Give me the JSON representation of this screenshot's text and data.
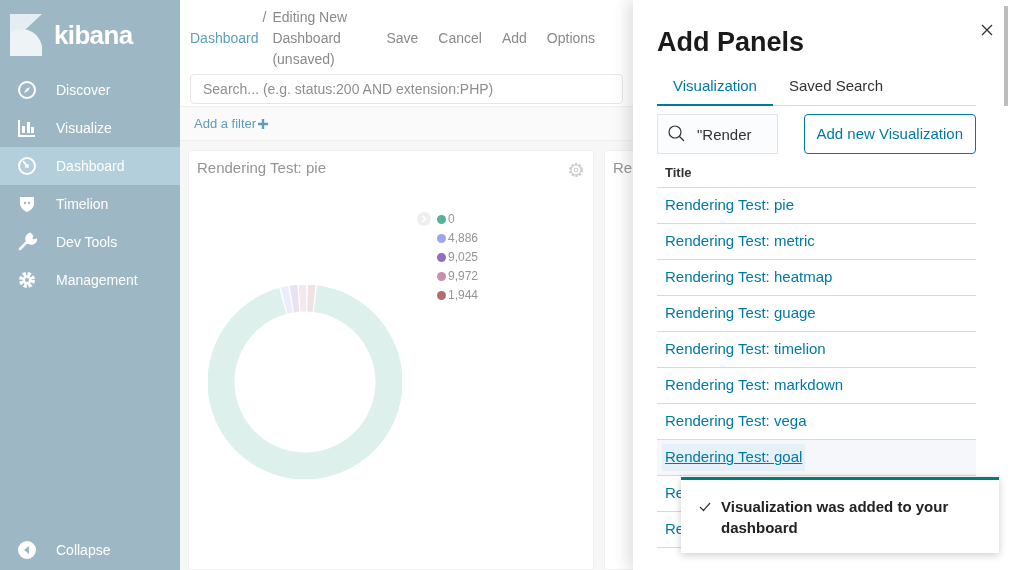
{
  "sidebar": {
    "brand": "kibana",
    "items": [
      {
        "label": "Discover",
        "selected": false
      },
      {
        "label": "Visualize",
        "selected": false
      },
      {
        "label": "Dashboard",
        "selected": true
      },
      {
        "label": "Timelion",
        "selected": false
      },
      {
        "label": "Dev Tools",
        "selected": false
      },
      {
        "label": "Management",
        "selected": false
      }
    ],
    "collapse": "Collapse"
  },
  "top_nav": {
    "breadcrumb": "Dashboard",
    "separator": "/",
    "page_title": "Editing New Dashboard (unsaved)",
    "actions": [
      "Save",
      "Cancel",
      "Add",
      "Options"
    ]
  },
  "query_bar": {
    "placeholder": "Search... (e.g. status:200 AND extension:PHP)"
  },
  "filter_bar": {
    "add_filter": "Add a filter"
  },
  "panels": [
    {
      "title": "Rendering Test: pie",
      "kind": "donut",
      "legend": [
        {
          "label": "0",
          "color": "#54b399"
        },
        {
          "label": "4,886",
          "color": "#9aa7f0"
        },
        {
          "label": "9,025",
          "color": "#9170b8"
        },
        {
          "label": "9,972",
          "color": "#ca8eae"
        },
        {
          "label": "1,944",
          "color": "#b46d6d"
        }
      ]
    },
    {
      "title": "Re",
      "kind": "cut"
    }
  ],
  "flyout": {
    "title": "Add Panels",
    "tabs": [
      {
        "label": "Visualization",
        "selected": true
      },
      {
        "label": "Saved Search",
        "selected": false
      }
    ],
    "search": {
      "value": "\"Render"
    },
    "add_button": "Add new Visualization",
    "table": {
      "columns": [
        "Title"
      ],
      "rows": [
        {
          "title": "Rendering Test: pie",
          "focused": false
        },
        {
          "title": "Rendering Test: metric",
          "focused": false
        },
        {
          "title": "Rendering Test: heatmap",
          "focused": false
        },
        {
          "title": "Rendering Test: guage",
          "focused": false
        },
        {
          "title": "Rendering Test: timelion",
          "focused": false
        },
        {
          "title": "Rendering Test: markdown",
          "focused": false
        },
        {
          "title": "Rendering Test: vega",
          "focused": false
        },
        {
          "title": "Rendering Test: goal",
          "focused": true
        },
        {
          "title": "Re",
          "focused": false
        },
        {
          "title": "Re",
          "focused": false
        }
      ]
    }
  },
  "toast": {
    "message": "Visualization was added to your dashboard"
  }
}
